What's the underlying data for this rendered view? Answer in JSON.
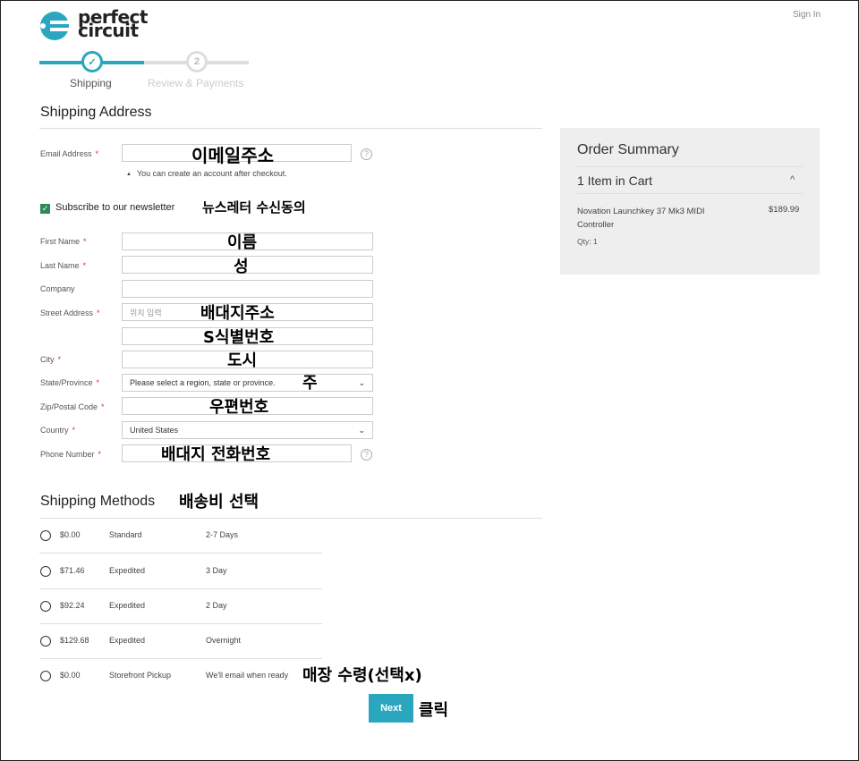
{
  "header": {
    "logo_text_line1": "perfect",
    "logo_text_line2": "circuit",
    "signin": "Sign In"
  },
  "progress": {
    "steps": [
      {
        "label": "Shipping",
        "marker": "✓"
      },
      {
        "label": "Review & Payments",
        "marker": "2"
      }
    ],
    "completed_fraction": 0.5
  },
  "shipping_address": {
    "title": "Shipping Address",
    "email_label": "Email Address",
    "email_annotation": "이메일주소",
    "email_hint": "You can create an account after checkout.",
    "newsletter_label": "Subscribe to our newsletter",
    "newsletter_annotation": "뉴스레터 수신동의",
    "first_name_label": "First Name",
    "first_name_annotation": "이름",
    "last_name_label": "Last Name",
    "last_name_annotation": "성",
    "company_label": "Company",
    "street_label": "Street Address",
    "street_placeholder": "위치 입력",
    "street_annotation": "배대지주소",
    "street2_annotation": "S식별번호",
    "city_label": "City",
    "city_annotation": "도시",
    "state_label": "State/Province",
    "state_value": "Please select a region, state or province.",
    "state_annotation": "주",
    "zip_label": "Zip/Postal Code",
    "zip_annotation": "우편번호",
    "country_label": "Country",
    "country_value": "United States",
    "phone_label": "Phone Number",
    "phone_annotation": "배대지 전화번호",
    "help_glyph": "?",
    "required_mark": "*"
  },
  "shipping_methods": {
    "title": "Shipping Methods",
    "title_annotation": "배송비 선택",
    "rows": [
      {
        "price": "$0.00",
        "carrier": "Standard",
        "time": "2-7 Days"
      },
      {
        "price": "$71.46",
        "carrier": "Expedited",
        "time": "3 Day"
      },
      {
        "price": "$92.24",
        "carrier": "Expedited",
        "time": "2 Day"
      },
      {
        "price": "$129.68",
        "carrier": "Expedited",
        "time": "Overnight"
      },
      {
        "price": "$0.00",
        "carrier": "Storefront Pickup",
        "time": "We'll email when ready"
      }
    ],
    "pickup_annotation": "매장 수령(선택x)",
    "next_label": "Next",
    "next_annotation": "클릭"
  },
  "order_summary": {
    "title": "Order Summary",
    "items_in_cart": "1 Item in Cart",
    "caret": "^",
    "product_name": "Novation Launchkey 37 Mk3 MIDI Controller",
    "product_price": "$189.99",
    "qty": "Qty: 1"
  },
  "colors": {
    "accent": "#2aa7bf",
    "checkbox": "#2e8b57"
  },
  "icons": [
    "logo-icon",
    "check-icon",
    "help-icon",
    "chevron-down-icon",
    "chevron-up-icon",
    "triangle-up-icon"
  ]
}
